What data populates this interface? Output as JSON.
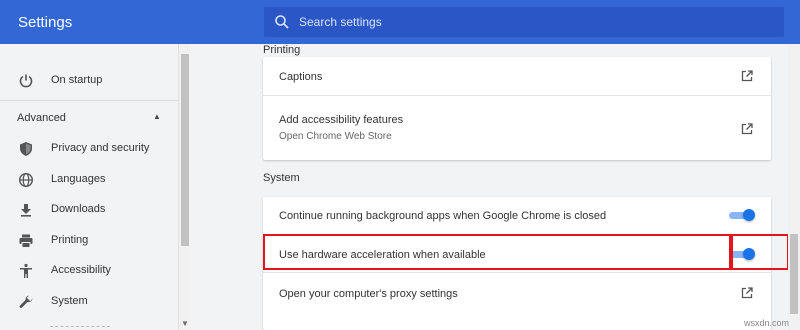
{
  "header": {
    "title": "Settings",
    "search_placeholder": "Search settings"
  },
  "sidebar": {
    "items_top": [
      {
        "label": "On startup",
        "icon": "power-icon"
      }
    ],
    "advanced_label": "Advanced",
    "items": [
      {
        "label": "Privacy and security",
        "icon": "shield-icon"
      },
      {
        "label": "Languages",
        "icon": "globe-icon"
      },
      {
        "label": "Downloads",
        "icon": "download-icon"
      },
      {
        "label": "Printing",
        "icon": "printer-icon"
      },
      {
        "label": "Accessibility",
        "icon": "accessibility-icon"
      },
      {
        "label": "System",
        "icon": "wrench-icon"
      }
    ]
  },
  "main": {
    "printing_title": "Printing",
    "captions_label": "Captions",
    "add_access_label": "Add accessibility features",
    "add_access_sub": "Open Chrome Web Store",
    "system_title": "System",
    "bg_apps_label": "Continue running background apps when Google Chrome is closed",
    "hw_accel_label": "Use hardware acceleration when available",
    "proxy_label": "Open your computer's proxy settings",
    "bg_apps_enabled": true,
    "hw_accel_enabled": true
  },
  "watermark": "wsxdn.com",
  "colors": {
    "header": "#3367d6",
    "toggle_on": "#1a73e8",
    "highlight": "#e3141e"
  }
}
